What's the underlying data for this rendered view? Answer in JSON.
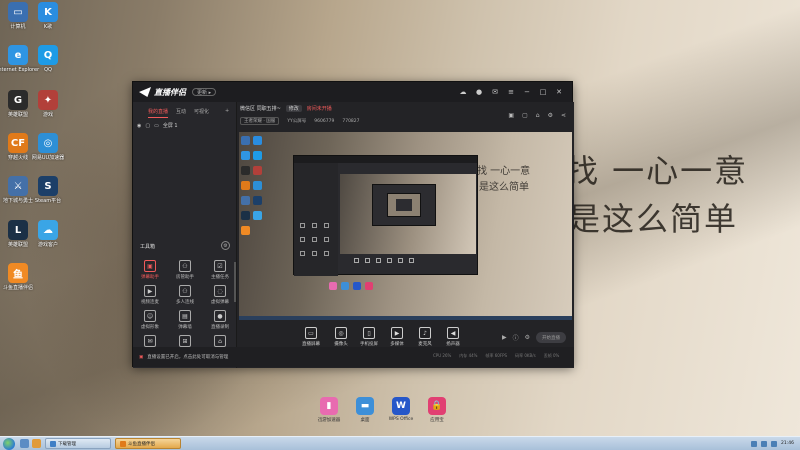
{
  "desktop": {
    "background_text": [
      "找 一心一意",
      "是这么简单"
    ],
    "icons": [
      {
        "label": "计算机",
        "icon": "computer-icon",
        "color": "#3a6fb0",
        "glyph": "▭"
      },
      {
        "label": "K歌",
        "icon": "kuwo-icon",
        "color": "#2a8de0",
        "glyph": "K"
      },
      {
        "label": "Internet Explorer",
        "icon": "ie-icon",
        "color": "#2f95e3",
        "glyph": "e"
      },
      {
        "label": "QQ",
        "icon": "qq-icon",
        "color": "#1e9be6",
        "glyph": "Q"
      },
      {
        "label": "英雄联盟",
        "icon": "game-g-icon",
        "color": "#2b2b2b",
        "glyph": "G"
      },
      {
        "label": "游戏",
        "icon": "game-icon",
        "color": "#b2403a",
        "glyph": "✦"
      },
      {
        "label": "穿越火线",
        "icon": "cf-icon",
        "color": "#e07a1a",
        "glyph": "CF"
      },
      {
        "label": "网易UU加速器",
        "icon": "uu-icon",
        "color": "#2d8fd6",
        "glyph": "◎"
      },
      {
        "label": "地下城与勇士",
        "icon": "dnf-icon",
        "color": "#4470a8",
        "glyph": "⚔"
      },
      {
        "label": "Steam平台",
        "icon": "steam-icon",
        "color": "#1c3f68",
        "glyph": "S"
      },
      {
        "label": "英雄联盟",
        "icon": "lol-icon",
        "color": "#1b3046",
        "glyph": "L"
      },
      {
        "label": "游戏客户",
        "icon": "cloud-icon",
        "color": "#3aa5e6",
        "glyph": "☁"
      },
      {
        "label": "斗鱼直播伴侣",
        "icon": "douyu-icon",
        "color": "#f08a24",
        "glyph": "鱼"
      }
    ],
    "dock": [
      {
        "label": "迅游加速器",
        "icon": "mouse-app-icon",
        "color": "#e86bb0",
        "glyph": "▮"
      },
      {
        "label": "桌面",
        "icon": "folder-app-icon",
        "color": "#3d8fd8",
        "glyph": "▬"
      },
      {
        "label": "WPS Office",
        "icon": "wps-icon",
        "color": "#2657c9",
        "glyph": "W"
      },
      {
        "label": "应用宝",
        "icon": "lock-app-icon",
        "color": "#e13f72",
        "glyph": "🔒"
      }
    ]
  },
  "app": {
    "name": "直播伴侣",
    "version_pill": "更新 ▸",
    "left_tabs": [
      "我的直播",
      "互动",
      "可视化"
    ],
    "scene": "全屏 1",
    "tools_title": "工具箱",
    "tools": [
      {
        "label": "弹幕助手",
        "icon": "danmaku-icon",
        "hot": true
      },
      {
        "label": "房管助手",
        "icon": "person-icon",
        "hot": false
      },
      {
        "label": "主播任务",
        "icon": "task-icon",
        "hot": false
      },
      {
        "label": "视频连麦",
        "icon": "video-call-icon",
        "hot": false
      },
      {
        "label": "多人连线",
        "icon": "multi-user-icon",
        "hot": false
      },
      {
        "label": "虚拟弹幕",
        "icon": "virtual-icon",
        "hot": false
      },
      {
        "label": "虚拟形象",
        "icon": "avatar-icon",
        "hot": false
      },
      {
        "label": "弹幕墙",
        "icon": "wall-icon",
        "hot": false
      },
      {
        "label": "直播录制",
        "icon": "record-icon",
        "hot": false
      },
      {
        "label": "发送消息",
        "icon": "message-icon",
        "hot": false
      },
      {
        "label": "",
        "icon": "fan-icon",
        "hot": false
      },
      {
        "label": "",
        "icon": "gift-icon",
        "hot": false
      }
    ],
    "room": {
      "title": "微信区 同职五排~",
      "tag": "修改",
      "warning": "房间未开播",
      "category": "王者荣耀 · 国服",
      "room_id": "YY公屏号",
      "fans": "9606779",
      "heat": "770827"
    },
    "preview_text": [
      "找 一心一意",
      "是这么简单"
    ],
    "bottom_tools": [
      {
        "label": "直播屏幕",
        "icon": "screen-icon"
      },
      {
        "label": "摄像头",
        "icon": "camera-icon"
      },
      {
        "label": "手机投屏",
        "icon": "phone-icon"
      },
      {
        "label": "多媒体",
        "icon": "media-icon"
      },
      {
        "label": "麦克风",
        "icon": "mic-icon"
      },
      {
        "label": "扬声器",
        "icon": "speaker-icon"
      }
    ],
    "start_button": "开始直播",
    "status_text": "直播设置已开启，点击此处可取消与管理",
    "stats": [
      "CPU 26%",
      "内存 44%",
      "帧率 60FPS",
      "码率 0KB/s",
      "丢帧 0%"
    ]
  },
  "taskbar": {
    "tasks": [
      {
        "label": "下载管理",
        "active": false,
        "color": "#3f7fc6"
      },
      {
        "label": "斗鱼直播伴侣",
        "active": true,
        "color": "#e07a1a"
      }
    ],
    "time": "21:46"
  }
}
